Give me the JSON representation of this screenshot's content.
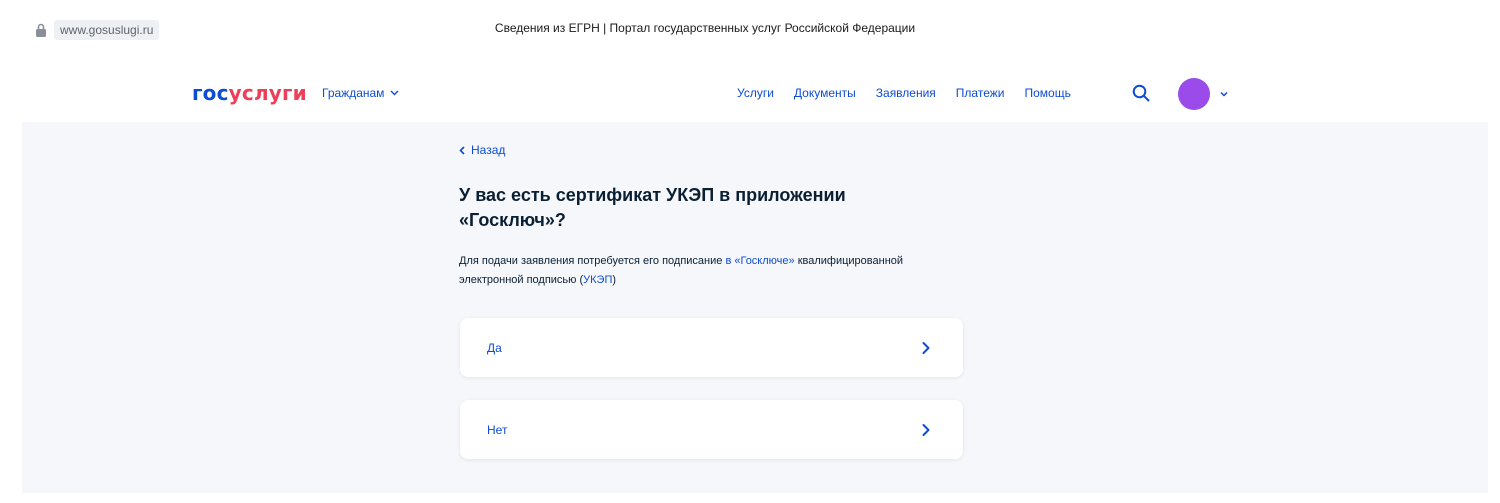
{
  "browser": {
    "url": "www.gosuslugi.ru",
    "page_title": "Сведения из ЕГРН | Портал государственных услуг Российской Федерации"
  },
  "header": {
    "logo_part1": "гос",
    "logo_part2": "услуги",
    "audience": "Гражданам",
    "nav": [
      "Услуги",
      "Документы",
      "Заявления",
      "Платежи",
      "Помощь"
    ],
    "avatar_color": "#9b4bea"
  },
  "main": {
    "back_label": "Назад",
    "question": "У вас есть сертификат УКЭП в приложении «Госключ»?",
    "description_part1": "Для подачи заявления потребуется его подписание ",
    "description_link1": "в «Госключе»",
    "description_part2": " квалифицированной электронной подписью (",
    "description_link2": "УКЭП",
    "description_part3": ")",
    "options": [
      {
        "label": "Да"
      },
      {
        "label": "Нет"
      }
    ]
  },
  "colors": {
    "accent": "#0d4cd3",
    "brand_red": "#ee3f58",
    "text": "#0b1f33",
    "background": "#f5f7fa"
  }
}
